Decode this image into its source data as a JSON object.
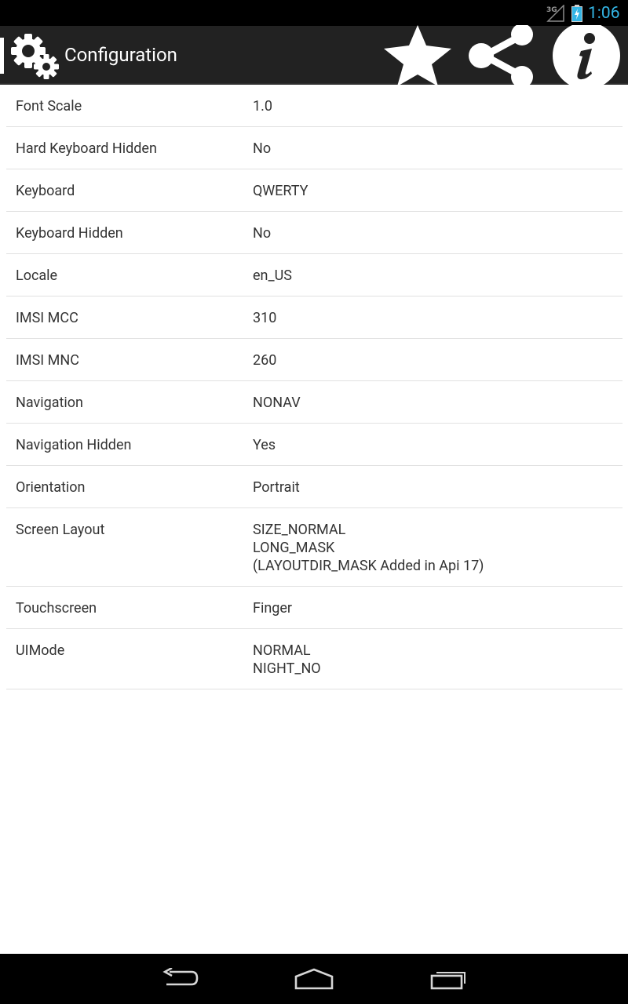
{
  "status_bar": {
    "network_type": "3G",
    "time": "1:06",
    "clock_color": "#33b5e5"
  },
  "action_bar": {
    "title": "Configuration",
    "app_icon": "gears-icon",
    "actions": [
      "star-icon",
      "share-icon",
      "info-icon"
    ]
  },
  "config": {
    "rows": [
      {
        "key": "Font Scale",
        "values": [
          "1.0"
        ]
      },
      {
        "key": "Hard Keyboard Hidden",
        "values": [
          "No"
        ]
      },
      {
        "key": "Keyboard",
        "values": [
          "QWERTY"
        ]
      },
      {
        "key": "Keyboard Hidden",
        "values": [
          "No"
        ]
      },
      {
        "key": "Locale",
        "values": [
          "en_US"
        ]
      },
      {
        "key": "IMSI MCC",
        "values": [
          "310"
        ]
      },
      {
        "key": "IMSI MNC",
        "values": [
          "260"
        ]
      },
      {
        "key": "Navigation",
        "values": [
          "NONAV"
        ]
      },
      {
        "key": "Navigation Hidden",
        "values": [
          "Yes"
        ]
      },
      {
        "key": "Orientation",
        "values": [
          "Portrait"
        ]
      },
      {
        "key": "Screen Layout",
        "values": [
          "SIZE_NORMAL",
          "LONG_MASK",
          "(LAYOUTDIR_MASK Added in Api 17)"
        ]
      },
      {
        "key": "Touchscreen",
        "values": [
          "Finger"
        ]
      },
      {
        "key": "UIMode",
        "values": [
          "NORMAL",
          "NIGHT_NO"
        ]
      }
    ]
  },
  "nav_bar": {
    "buttons": [
      "back-icon",
      "home-icon",
      "recents-icon"
    ]
  }
}
